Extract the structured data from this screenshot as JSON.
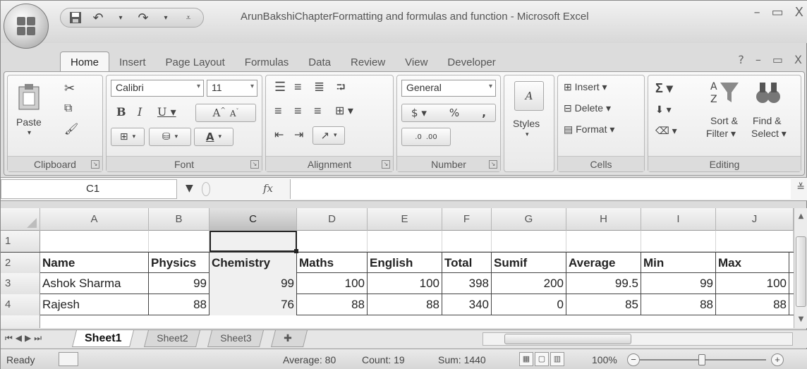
{
  "window": {
    "title": "ArunBakshiChapterFormatting and formulas and function - Microsoft Excel",
    "controls": [
      "–",
      "▭",
      "X"
    ]
  },
  "tabs": [
    "Home",
    "Insert",
    "Page Layout",
    "Formulas",
    "Data",
    "Review",
    "View",
    "Developer"
  ],
  "tab_right_controls": [
    "?",
    "–",
    "▭",
    "X"
  ],
  "ribbon": {
    "clipboard": {
      "label": "Clipboard",
      "paste": "Paste"
    },
    "font": {
      "label": "Font",
      "name": "Calibri",
      "size": "11"
    },
    "alignment": {
      "label": "Alignment"
    },
    "number": {
      "label": "Number",
      "format": "General",
      "currency": "$",
      "percent": "%",
      "comma": ",",
      "inc_dec": ".0",
      "dec_dec": ".00"
    },
    "styles": {
      "label": "Styles"
    },
    "cells": {
      "label": "Cells",
      "insert": "Insert",
      "delete": "Delete",
      "format": "Format"
    },
    "editing": {
      "label": "Editing",
      "sort_filter_1": "Sort &",
      "sort_filter_2": "Filter",
      "find_select_1": "Find &",
      "find_select_2": "Select"
    }
  },
  "formula_bar": {
    "name_box": "C1",
    "fx_label": "fx",
    "formula": ""
  },
  "columns": [
    "A",
    "B",
    "C",
    "D",
    "E",
    "F",
    "G",
    "H",
    "I",
    "J"
  ],
  "selected_column": "C",
  "rows": [
    {
      "num": "1",
      "cells": [
        "",
        "",
        "",
        "",
        "",
        "",
        "",
        "",
        "",
        ""
      ]
    },
    {
      "num": "2",
      "cells": [
        "Name",
        "Physics",
        "Chemistry",
        "Maths",
        "English",
        "Total",
        "Sumif",
        "Average",
        "Min",
        "Max"
      ]
    },
    {
      "num": "3",
      "cells": [
        "Ashok Sharma",
        "99",
        "99",
        "100",
        "100",
        "398",
        "200",
        "99.5",
        "99",
        "100"
      ]
    },
    {
      "num": "4",
      "cells": [
        "Rajesh",
        "88",
        "76",
        "88",
        "88",
        "340",
        "0",
        "85",
        "88",
        "88"
      ]
    }
  ],
  "sheet_tabs": [
    "Sheet1",
    "Sheet2",
    "Sheet3"
  ],
  "active_sheet": "Sheet1",
  "status": {
    "mode": "Ready",
    "average": "Average: 80",
    "count": "Count: 19",
    "sum": "Sum: 1440",
    "zoom": "100%",
    "zoom_level": 1.0
  }
}
